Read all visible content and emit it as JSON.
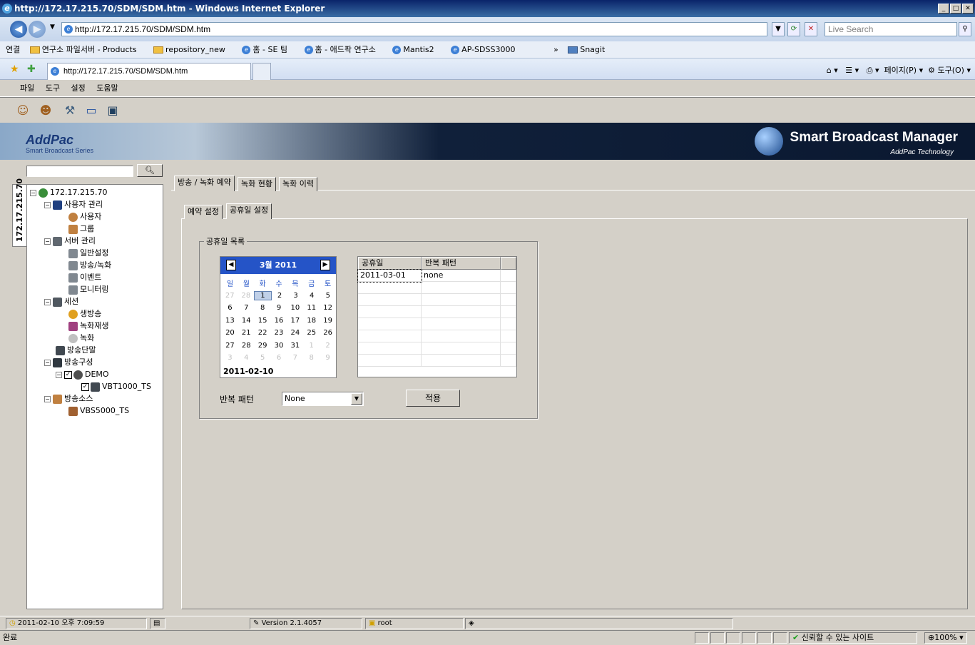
{
  "window": {
    "title": "http://172.17.215.70/SDM/SDM.htm - Windows Internet Explorer"
  },
  "address": {
    "url": "http://172.17.215.70/SDM/SDM.htm",
    "search_placeholder": "Live Search"
  },
  "links": {
    "label": "연결",
    "items": [
      "연구소 파일서버 - Products",
      "repository_new",
      "홈 - SE 팀",
      "홈 - 애드팍 연구소",
      "Mantis2",
      "AP-SDSS3000"
    ],
    "more": "»",
    "snagit": "Snagit"
  },
  "ie_tab": {
    "label": "http://172.17.215.70/SDM/SDM.htm"
  },
  "command_bar": {
    "page": "페이지(P)",
    "tools": "도구(O)"
  },
  "app_menu": [
    "파일",
    "도구",
    "설정",
    "도움말"
  ],
  "banner": {
    "logo": "AddPac",
    "logo_sub": "Smart Broadcast Series",
    "product": "Smart Broadcast Manager",
    "company": "AddPac Technology"
  },
  "left": {
    "vertical_tab": "172.17.215.70",
    "tree": {
      "root": "172.17.215.70",
      "user_mgmt": "사용자 관리",
      "user": "사용자",
      "group": "그룹",
      "server_mgmt": "서버 관리",
      "general": "일반설정",
      "broadcast_record": "방송/녹화",
      "event": "이벤트",
      "monitoring": "모니터링",
      "session": "세션",
      "live": "생방송",
      "record_play": "녹화재생",
      "record": "녹화",
      "terminal": "방송단말",
      "config": "방송구성",
      "demo": "DEMO",
      "vbt": "VBT1000_TS",
      "source": "방송소스",
      "vbs": "VBS5000_TS"
    }
  },
  "main": {
    "tabs": [
      "방송 / 녹화 예약",
      "녹화 현황",
      "녹화 이력"
    ],
    "subtabs": [
      "예약 설정",
      "공휴일 설정"
    ],
    "fieldset_title": "공휴일 목록",
    "calendar": {
      "month_label": "3월 2011",
      "prev": "◀",
      "next": "▶",
      "weekdays": [
        "일",
        "월",
        "화",
        "수",
        "목",
        "금",
        "토"
      ],
      "weeks": [
        [
          "27",
          "28",
          "1",
          "2",
          "3",
          "4",
          "5"
        ],
        [
          "6",
          "7",
          "8",
          "9",
          "10",
          "11",
          "12"
        ],
        [
          "13",
          "14",
          "15",
          "16",
          "17",
          "18",
          "19"
        ],
        [
          "20",
          "21",
          "22",
          "23",
          "24",
          "25",
          "26"
        ],
        [
          "27",
          "28",
          "29",
          "30",
          "31",
          "1",
          "2"
        ],
        [
          "3",
          "4",
          "5",
          "6",
          "7",
          "8",
          "9"
        ]
      ],
      "today": "2011-02-10"
    },
    "holiday_table": {
      "headers": [
        "공휴일",
        "반복 패턴"
      ],
      "rows": [
        [
          "2011-03-01",
          "none"
        ]
      ]
    },
    "repeat_label": "반복 패턴",
    "repeat_value": "None",
    "apply": "적용"
  },
  "app_status": {
    "datetime": "2011-02-10 오후 7:09:59",
    "version": "Version 2.1.4057",
    "user": "root"
  },
  "ie_status": {
    "left": "완료",
    "zone": "신뢰할 수 있는 사이트",
    "zoom": "100%"
  }
}
